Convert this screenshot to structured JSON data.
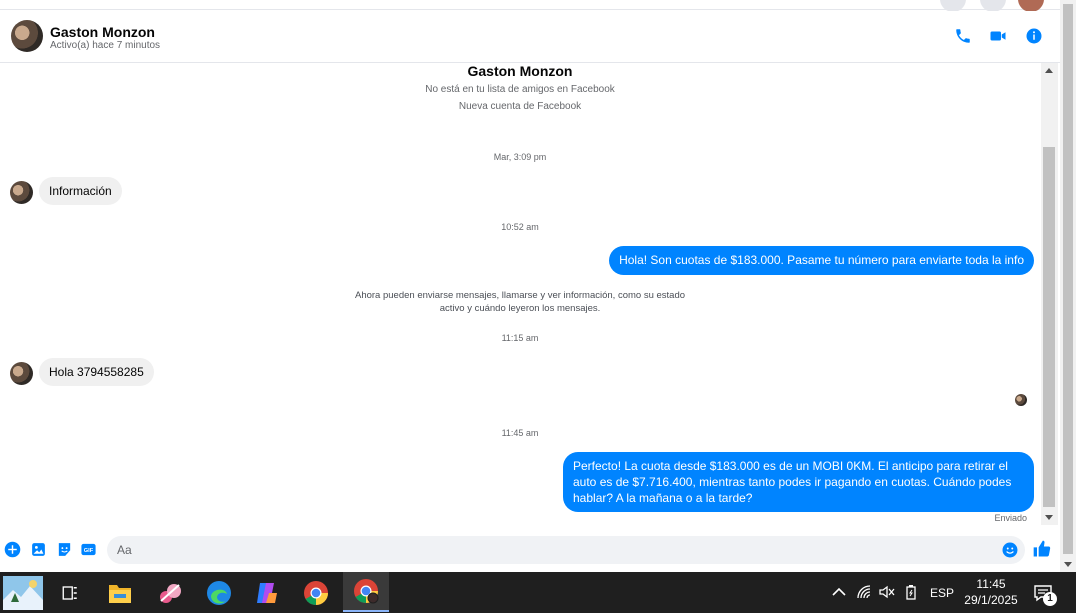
{
  "header": {
    "name": "Gaston Monzon",
    "status": "Activo(a) hace 7 minutos"
  },
  "intro": {
    "name": "Gaston Monzon",
    "line1": "No está en tu lista de amigos en Facebook",
    "line2": "Nueva cuenta de Facebook"
  },
  "thread": {
    "time1": "Mar, 3:09 pm",
    "msg1": "Información",
    "time2": "10:52 am",
    "msg2": "Hola! Son cuotas de $183.000. Pasame tu número para enviarte toda la info",
    "notice_line1": "Ahora pueden enviarse mensajes, llamarse y ver información, como su estado",
    "notice_line2": "activo y cuándo leyeron los mensajes.",
    "time3": "11:15 am",
    "msg3": "Hola 3794558285",
    "time4": "11:45 am",
    "msg4_line1": "Perfecto! La cuota desde $183.000 es de un MOBI 0KM. El anticipo para retirar el",
    "msg4_line2": "auto es de $7.716.400, mientras tanto podes ir pagando en cuotas. Cuándo podes",
    "msg4_line3": "hablar? A la mañana o a la tarde?",
    "sent_label": "Enviado"
  },
  "composer": {
    "placeholder": "Aa"
  },
  "taskbar": {
    "language": "ESP",
    "time": "11:45",
    "date": "29/1/2025",
    "notification_count": "1"
  },
  "colors": {
    "accent": "#0084ff",
    "incoming_bubble": "#f0f0f0",
    "taskbar": "#1f1f1f"
  }
}
